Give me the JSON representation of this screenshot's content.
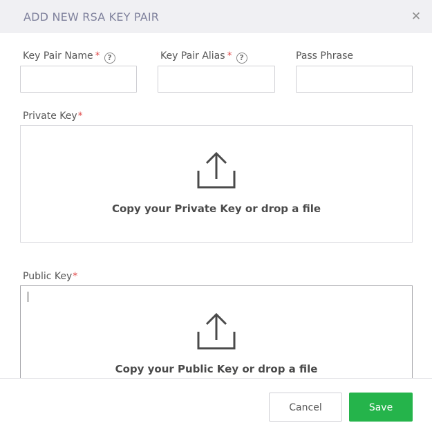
{
  "dialog": {
    "title": "ADD NEW RSA KEY PAIR",
    "close_icon": "close-icon"
  },
  "fields": {
    "key_pair_name": {
      "label": "Key Pair Name",
      "required_mark": "*",
      "help": "?",
      "value": ""
    },
    "key_pair_alias": {
      "label": "Key Pair Alias",
      "required_mark": "*",
      "help": "?",
      "value": ""
    },
    "pass_phrase": {
      "label": "Pass Phrase",
      "value": ""
    }
  },
  "private_key": {
    "label": "Private Key",
    "required_mark": "*",
    "drop_text": "Copy your Private Key or drop a file",
    "icon": "upload-icon"
  },
  "public_key": {
    "label": "Public Key",
    "required_mark": "*",
    "drop_text": "Copy your Public Key or drop a file",
    "icon": "upload-icon"
  },
  "footer": {
    "cancel_label": "Cancel",
    "save_label": "Save"
  },
  "colors": {
    "header_bg": "#f0f0f3",
    "title": "#7f819c",
    "required": "#e04848",
    "save": "#25b44b"
  }
}
